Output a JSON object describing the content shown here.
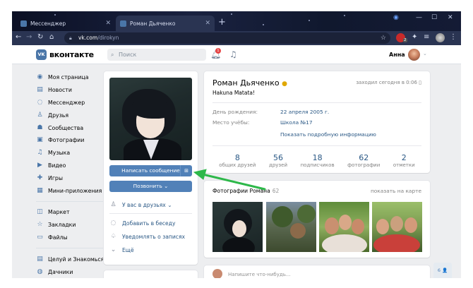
{
  "browser": {
    "tabs": [
      {
        "title": "Мессенджер",
        "active": false
      },
      {
        "title": "Роман Дьяченко",
        "active": true
      }
    ],
    "url_host": "vk.com",
    "url_path": "/dirokyn",
    "ext_badge": "2"
  },
  "header": {
    "logo_text": "вконтакте",
    "logo_mark": "VK",
    "search_placeholder": "Поиск",
    "notif_count": "1",
    "user_name": "Анна"
  },
  "sidebar": {
    "items": [
      {
        "label": "Моя страница",
        "icon": "user-icon",
        "glyph": "◉"
      },
      {
        "label": "Новости",
        "icon": "news-icon",
        "glyph": "▤"
      },
      {
        "label": "Мессенджер",
        "icon": "chat-icon",
        "glyph": "◌",
        "count": "1"
      },
      {
        "label": "Друзья",
        "icon": "friends-icon",
        "glyph": "♙"
      },
      {
        "label": "Сообщества",
        "icon": "groups-icon",
        "glyph": "☗"
      },
      {
        "label": "Фотографии",
        "icon": "photo-icon",
        "glyph": "▣"
      },
      {
        "label": "Музыка",
        "icon": "music-icon",
        "glyph": "♫"
      },
      {
        "label": "Видео",
        "icon": "video-icon",
        "glyph": "▶"
      },
      {
        "label": "Игры",
        "icon": "games-icon",
        "glyph": "✚",
        "count": "2"
      },
      {
        "label": "Мини-приложения",
        "icon": "apps-icon",
        "glyph": "▦"
      }
    ],
    "items2": [
      {
        "label": "Маркет",
        "icon": "market-icon",
        "glyph": "◫"
      },
      {
        "label": "Закладки",
        "icon": "bookmark-icon",
        "glyph": "☆"
      },
      {
        "label": "Файлы",
        "icon": "file-icon",
        "glyph": "▭"
      }
    ],
    "items3": [
      {
        "label": "Целуй и Знакомься",
        "icon": "app-icon",
        "glyph": "▤"
      },
      {
        "label": "Дачники",
        "icon": "game-icon",
        "glyph": "◍"
      }
    ]
  },
  "profile": {
    "send_message": "Написать сообщение",
    "call": "Позвонить ⌄",
    "friend_status": "У вас в друзьях ⌄",
    "add_to_chat": "Добавить в беседу",
    "notify": "Уведомлять о записях",
    "more": "Ещё",
    "name": "Роман Дьяченко",
    "status": "Hakuna Matata!",
    "online": "заходил сегодня в 0:06",
    "birthday_label": "День рождения:",
    "birthday_value": "22 апреля 2005 г.",
    "school_label": "Место учёбы:",
    "school_value": "Школа №17",
    "more_info": "Показать подробную информацию",
    "counters": [
      {
        "n": "8",
        "label": "общих друзей"
      },
      {
        "n": "56",
        "label": "друзей"
      },
      {
        "n": "18",
        "label": "подписчиков"
      },
      {
        "n": "62",
        "label": "фотографии"
      },
      {
        "n": "2",
        "label": "отметки"
      }
    ]
  },
  "photos": {
    "title": "Фотографии Романа",
    "count": "62",
    "map_link": "показать на карте"
  },
  "post": {
    "placeholder": "Напишите что-нибудь..."
  },
  "chat_mini": "6 👤"
}
